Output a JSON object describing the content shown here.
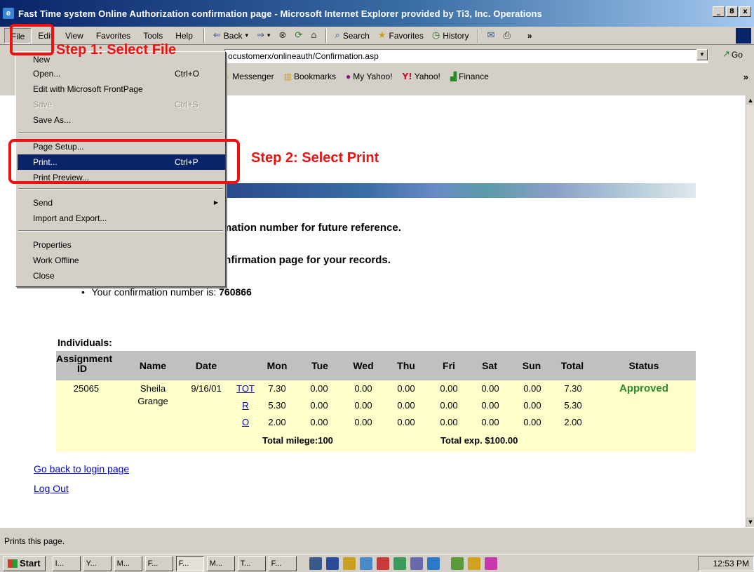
{
  "window": {
    "title": "Fast Time system Online Authorization confirmation page - Microsoft Internet Explorer provided by Ti3, Inc. Operations",
    "min": "_",
    "max": "8",
    "close": "x"
  },
  "menu": {
    "items": [
      "File",
      "Edit",
      "View",
      "Favorites",
      "Tools",
      "Help"
    ]
  },
  "toolbar": {
    "back": "Back",
    "search": "Search",
    "favorites": "Favorites",
    "history": "History"
  },
  "address": {
    "url": "ocustomerx/onlineauth/Confirmation.asp",
    "go": "Go"
  },
  "links": {
    "messenger": "Messenger",
    "bookmarks": "Bookmarks",
    "myyahoo": "My Yahoo!",
    "yahoo": "Yahoo!",
    "finance": "Finance"
  },
  "file_menu": {
    "new": "New",
    "open": "Open...",
    "open_sc": "Ctrl+O",
    "edit_fp": "Edit with Microsoft FrontPage",
    "save": "Save",
    "save_sc": "Ctrl+S",
    "save_as": "Save As...",
    "page_setup": "Page Setup...",
    "print": "Print...",
    "print_sc": "Ctrl+P",
    "print_preview": "Print Preview...",
    "send": "Send",
    "import_export": "Import and Export...",
    "properties": "Properties",
    "work_offline": "Work Offline",
    "close": "Close"
  },
  "annotations": {
    "step1": "Step 1:  Select File",
    "step2": "Step 2:  Select Print"
  },
  "page": {
    "line1": "rmation number for future reference.",
    "line2": "onfirmation page for your records.",
    "conf_prefix": "Your confirmation number is: ",
    "conf_number": "760866",
    "individuals_label": "Individuals:",
    "back_link": "Go back to login page",
    "logout_link": "Log Out"
  },
  "table": {
    "headers": [
      "Assignment ID",
      "Name",
      "Date",
      "Mon",
      "Tue",
      "Wed",
      "Thu",
      "Fri",
      "Sat",
      "Sun",
      "Total",
      "Status"
    ],
    "assignment_id": "25065",
    "name_first": "Sheila",
    "name_last": "Grange",
    "date": "9/16/01",
    "status": "Approved",
    "rows": [
      {
        "type": "TOT",
        "mon": "7.30",
        "tue": "0.00",
        "wed": "0.00",
        "thu": "0.00",
        "fri": "0.00",
        "sat": "0.00",
        "sun": "0.00",
        "total": "7.30"
      },
      {
        "type": "R",
        "mon": "5.30",
        "tue": "0.00",
        "wed": "0.00",
        "thu": "0.00",
        "fri": "0.00",
        "sat": "0.00",
        "sun": "0.00",
        "total": "5.30"
      },
      {
        "type": "O",
        "mon": "2.00",
        "tue": "0.00",
        "wed": "0.00",
        "thu": "0.00",
        "fri": "0.00",
        "sat": "0.00",
        "sun": "0.00",
        "total": "2.00"
      }
    ],
    "total_mileage": "Total milege:100",
    "total_exp": "Total exp. $100.00"
  },
  "status_bar": {
    "text": "Prints this page."
  },
  "taskbar": {
    "start": "Start",
    "buttons": [
      "I...",
      "Y...",
      "M...",
      "F...",
      "F...",
      "M...",
      "T...",
      "F..."
    ],
    "clock": "12:53 PM"
  }
}
